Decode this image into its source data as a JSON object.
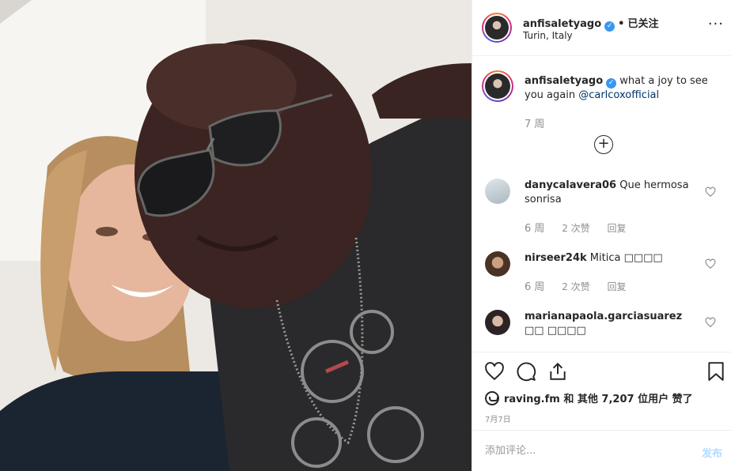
{
  "header": {
    "username": "anfisaletyago",
    "verified_mark": "✓",
    "separator": "•",
    "follow_label": "已关注",
    "location": "Turin, Italy",
    "more_label": "···"
  },
  "caption": {
    "username": "anfisaletyago",
    "text": "what a joy to see you again",
    "mention": "@carlcoxofficial",
    "time": "7 周",
    "load_more": "+"
  },
  "comments": [
    {
      "username": "danycalavera06",
      "text": "Que hermosa sonrisa",
      "time": "6 周",
      "likes": "2 次赞",
      "reply": "回复"
    },
    {
      "username": "nirseer24k",
      "text": "Mitica □□□□",
      "time": "6 周",
      "likes": "2 次赞",
      "reply": "回复"
    },
    {
      "username": "marianapaola.garciasuarez",
      "text": "□□ □□□□"
    }
  ],
  "likes": {
    "liker": "raving.fm",
    "middle": "和 其他",
    "count": "7,207",
    "suffix": "位用户 赞了"
  },
  "date": "7月7日",
  "add_comment": {
    "placeholder": "添加评论...",
    "post_label": "发布"
  },
  "icons": {
    "like": "heart-icon",
    "comment": "comment-icon",
    "share": "share-icon",
    "save": "bookmark-icon"
  },
  "colors": {
    "verified": "#3897f0",
    "mention": "#003569",
    "post_disabled": "#b3dbff",
    "muted": "#8e8e8e"
  }
}
